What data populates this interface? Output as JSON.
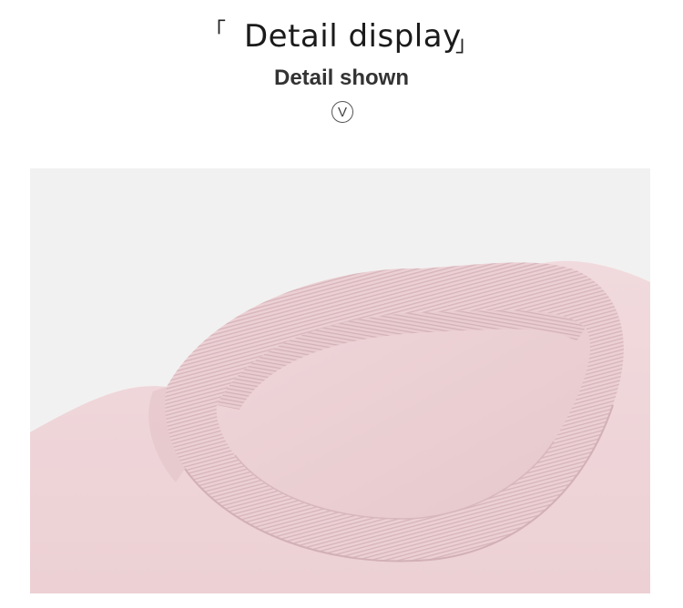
{
  "header": {
    "bracket_open": "「",
    "title": "Detail display",
    "bracket_close": "」",
    "subtitle": "Detail shown",
    "badge_letter": "V"
  },
  "photo": {
    "subject": "pink sweatshirt crew neck ribbed collar close-up",
    "colors": {
      "background": "#f2f1f1",
      "fabric": "#f0d8db",
      "fabric_shadow": "#e4c5ca",
      "rib": "#e9cdd1",
      "rib_line": "#d9b8be"
    }
  }
}
